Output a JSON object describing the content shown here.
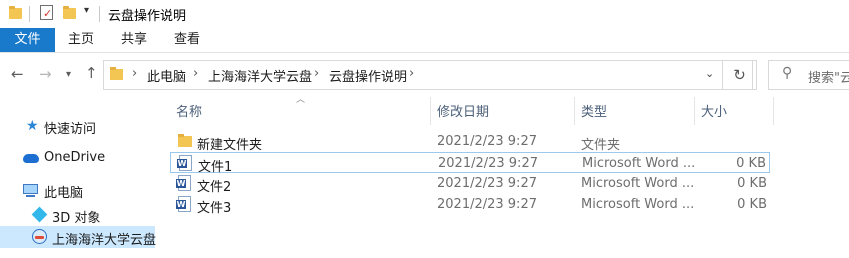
{
  "window": {
    "title": "云盘操作说明"
  },
  "ribbon": {
    "tabs": [
      "文件",
      "主页",
      "共享",
      "查看"
    ]
  },
  "address": {
    "crumbs": [
      "此电脑",
      "上海海洋大学云盘",
      "云盘操作说明"
    ],
    "search_placeholder": "搜索\"云"
  },
  "nav_pane": {
    "items": [
      {
        "label": "快速访问",
        "icon": "star-icon"
      },
      {
        "label": "OneDrive",
        "icon": "onedrive-cloud-icon"
      },
      {
        "label": "此电脑",
        "icon": "this-pc-icon"
      },
      {
        "label": "3D 对象",
        "icon": "3d-objects-icon"
      },
      {
        "label": "上海海洋大学云盘",
        "icon": "cloud-drive-icon",
        "selected": true
      }
    ]
  },
  "columns": {
    "name": "名称",
    "date": "修改日期",
    "type": "类型",
    "size": "大小"
  },
  "files": [
    {
      "name": "新建文件夹",
      "date": "2021/2/23 9:27",
      "type": "文件夹",
      "size": "",
      "icon": "folder-icon"
    },
    {
      "name": "文件1",
      "date": "2021/2/23 9:27",
      "type": "Microsoft Word ...",
      "size": "0 KB",
      "icon": "word-doc-icon"
    },
    {
      "name": "文件2",
      "date": "2021/2/23 9:27",
      "type": "Microsoft Word ...",
      "size": "0 KB",
      "icon": "word-doc-icon"
    },
    {
      "name": "文件3",
      "date": "2021/2/23 9:27",
      "type": "Microsoft Word ...",
      "size": "0 KB",
      "icon": "word-doc-icon"
    }
  ],
  "colors": {
    "accent": "#1979ca",
    "selection": "#cce8ff",
    "focus_border": "#99c9ef",
    "header_text": "#4c607a"
  }
}
